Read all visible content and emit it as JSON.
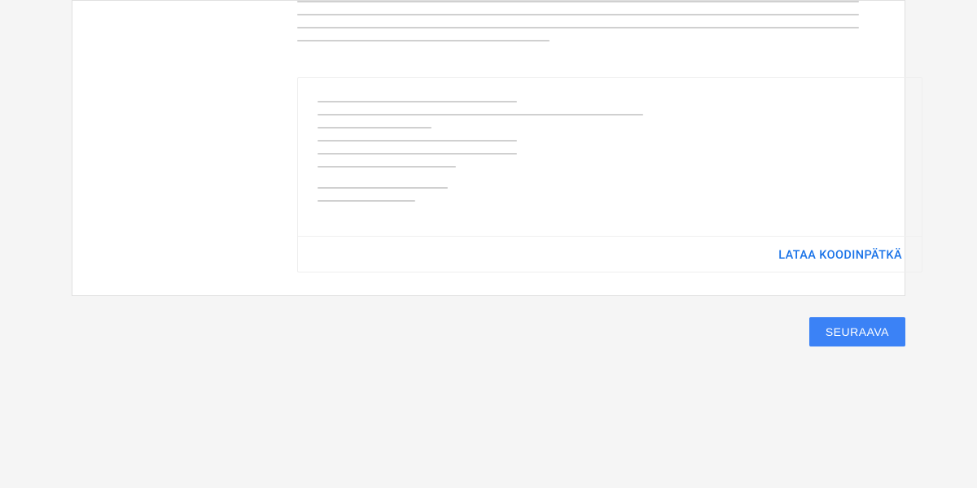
{
  "code_panel": {
    "download_label": "LATAA KOODINPÄTKÄ"
  },
  "actions": {
    "next_label": "SEURAAVA"
  }
}
